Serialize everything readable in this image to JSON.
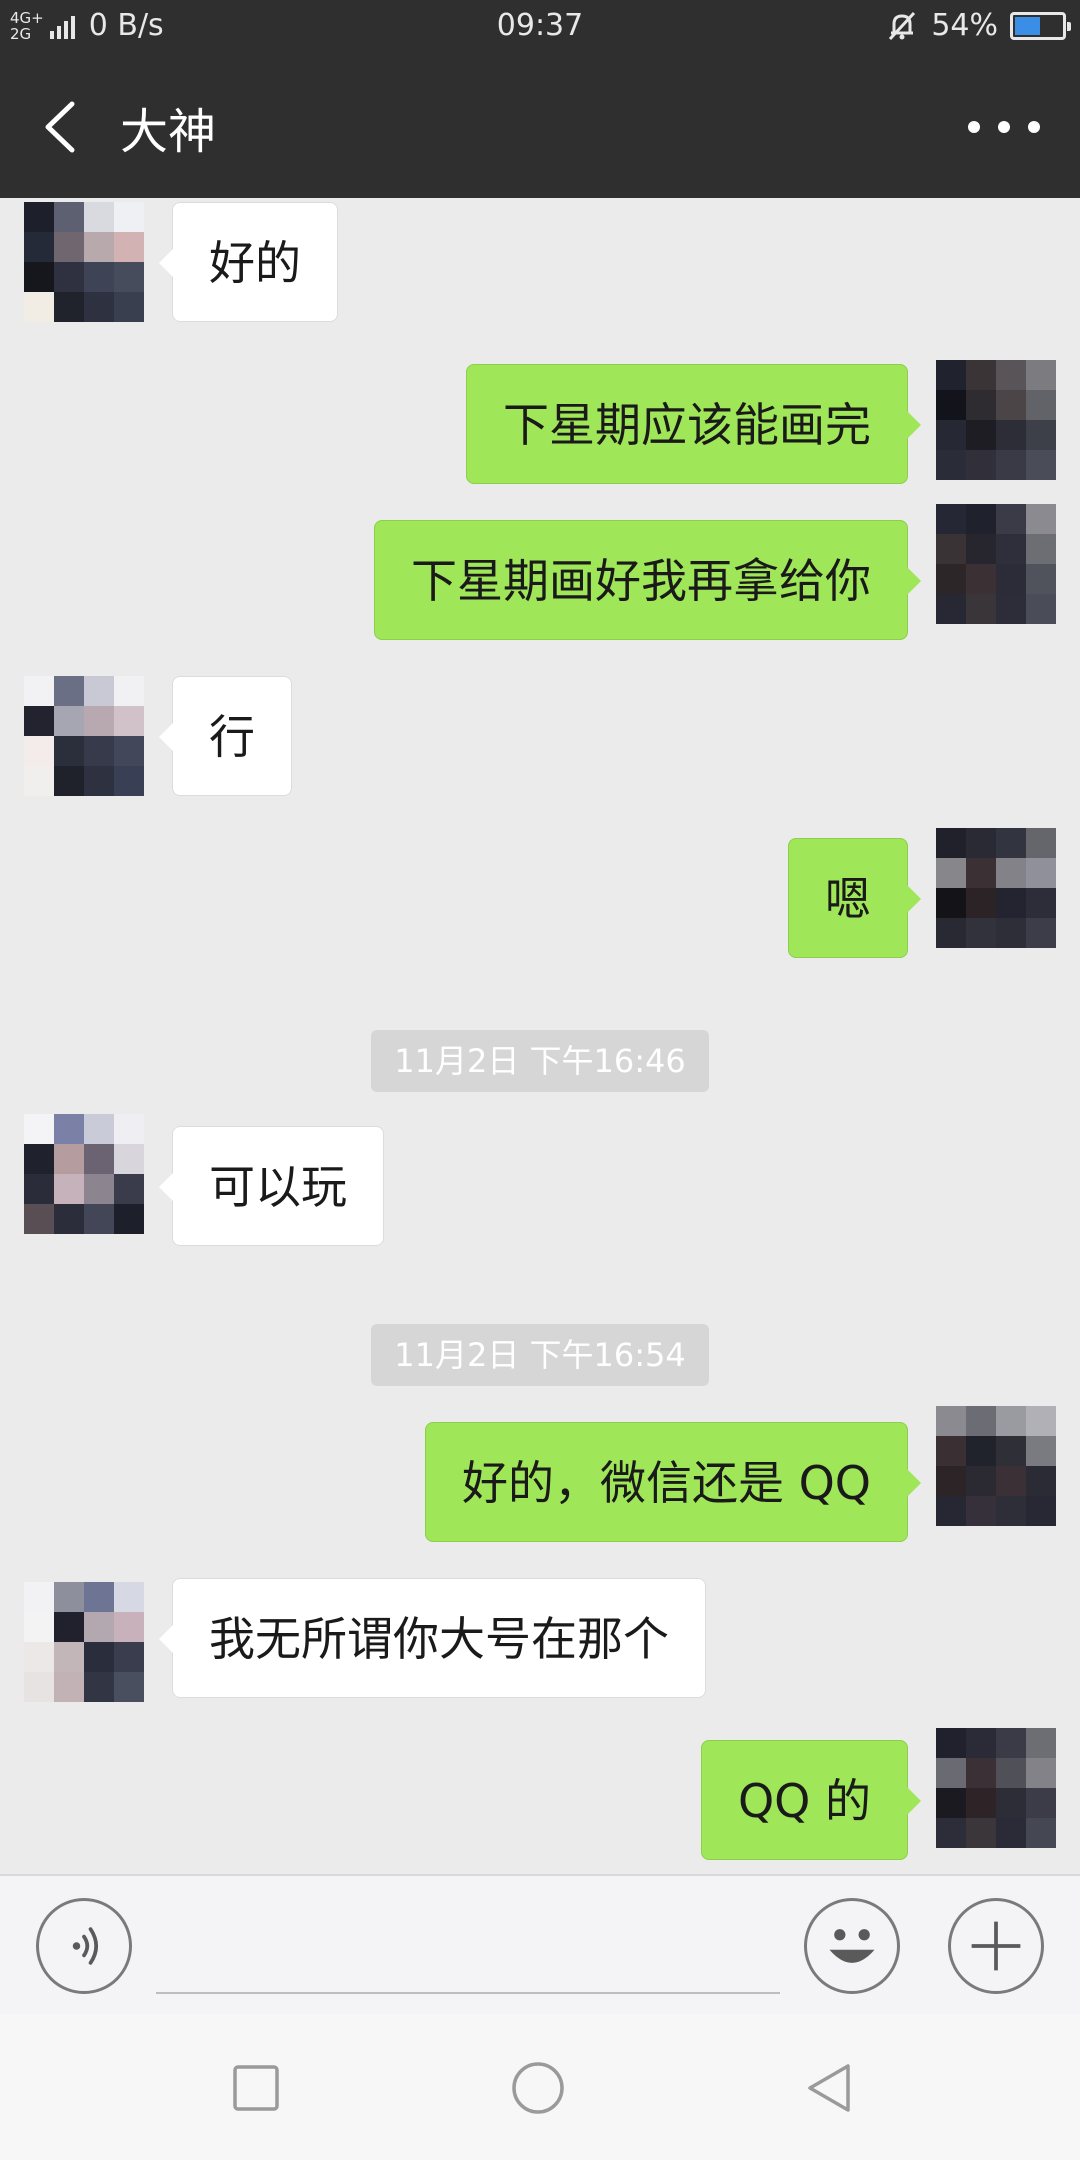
{
  "status_bar": {
    "network_type": "4G+\n2G",
    "speed": "0 B/s",
    "time": "09:37",
    "battery": "54%",
    "battery_level": 0.54
  },
  "header": {
    "title": "大神",
    "back_icon": "chevron-left-icon",
    "more_icon": "more-dots-icon"
  },
  "messages": [
    {
      "side": "in",
      "text": "好的"
    },
    {
      "side": "out",
      "text": "下星期应该能画完"
    },
    {
      "side": "out",
      "text": "下星期画好我再拿给你"
    },
    {
      "side": "in",
      "text": "行"
    },
    {
      "side": "out",
      "text": "嗯"
    },
    {
      "timestamp": "11月2日 下午16:46"
    },
    {
      "side": "in",
      "text": "可以玩"
    },
    {
      "timestamp": "11月2日 下午16:54"
    },
    {
      "side": "out",
      "text": "好的，微信还是 QQ"
    },
    {
      "side": "in",
      "text": "我无所谓你大号在那个"
    },
    {
      "side": "out",
      "text": "QQ 的"
    }
  ],
  "input_bar": {
    "voice_icon": "voice-icon",
    "emoji_icon": "emoji-icon",
    "plus_icon": "plus-icon"
  },
  "navigation": {
    "recent_icon": "square-icon",
    "home_icon": "circle-icon",
    "back_icon": "triangle-back-icon"
  },
  "colors": {
    "header_bg": "#2f2f2f",
    "chat_bg": "#ebebeb",
    "outgoing_bubble": "#9fe658",
    "incoming_bubble": "#ffffff",
    "battery_fill": "#3a8ee6"
  }
}
